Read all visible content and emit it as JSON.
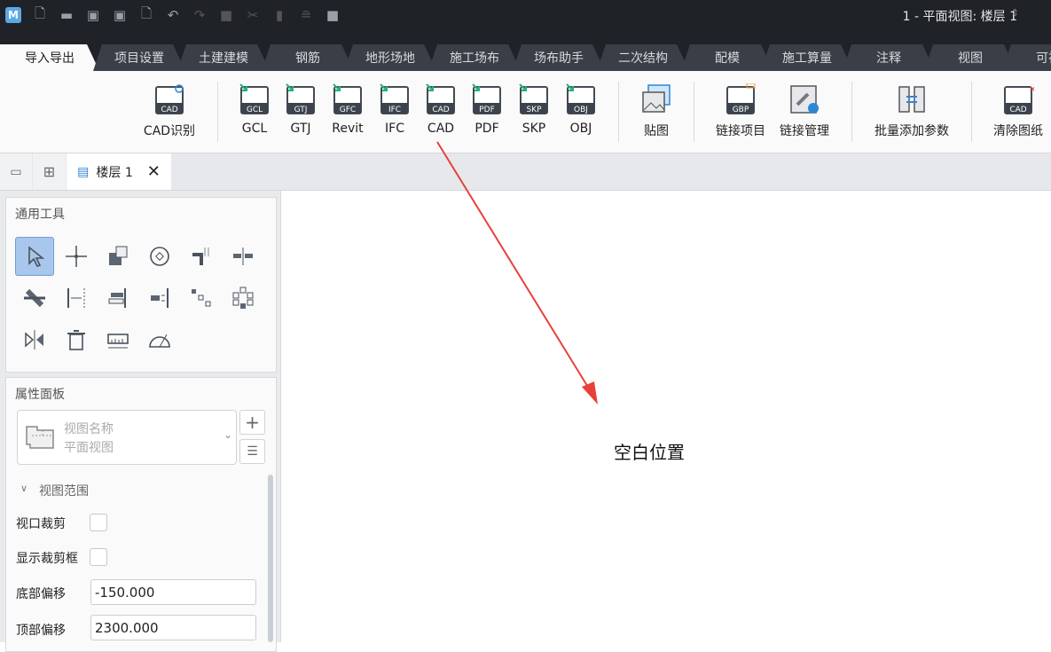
{
  "window": {
    "title": "1 - 平面视图: 楼层 1"
  },
  "quick_access": [
    "app-logo",
    "new-file",
    "open-folder",
    "save",
    "save-as",
    "close-file",
    "undo",
    "redo",
    "select-box",
    "cut",
    "paste",
    "stamp",
    "cube"
  ],
  "ribbon_tabs": [
    "导入导出",
    "项目设置",
    "土建建模",
    "钢筋",
    "地形场地",
    "施工场布",
    "场布助手",
    "二次结构",
    "配模",
    "施工算量",
    "注释",
    "视图",
    "可视"
  ],
  "ribbon_buttons": [
    {
      "label": "CAD识别",
      "badge": "CAD"
    },
    {
      "label": "GCL",
      "badge": "GCL"
    },
    {
      "label": "GTJ",
      "badge": "GTJ"
    },
    {
      "label": "Revit",
      "badge": "GFC"
    },
    {
      "label": "IFC",
      "badge": "IFC"
    },
    {
      "label": "CAD",
      "badge": "CAD"
    },
    {
      "label": "PDF",
      "badge": "PDF"
    },
    {
      "label": "SKP",
      "badge": "SKP"
    },
    {
      "label": "OBJ",
      "badge": "OBJ"
    },
    {
      "label": "贴图",
      "badge": ""
    },
    {
      "label": "链接项目",
      "badge": "GBP"
    },
    {
      "label": "链接管理",
      "badge": ""
    },
    {
      "label": "批量添加参数",
      "badge": ""
    },
    {
      "label": "清除图纸",
      "badge": "CAD"
    }
  ],
  "doc_tab": {
    "label": "楼层 1"
  },
  "tools_panel": {
    "title": "通用工具"
  },
  "properties": {
    "title": "属性面板",
    "view_name_label": "视图名称",
    "view_name_value": "平面视图",
    "section": "视图范围",
    "viewport_crop": "视口裁剪",
    "show_crop_box": "显示裁剪框",
    "bottom_offset_label": "底部偏移",
    "bottom_offset": "-150.000",
    "top_offset_label": "顶部偏移",
    "top_offset": "2300.000"
  },
  "annotation": {
    "text": "空白位置",
    "color": "#e8403a"
  },
  "colors": {
    "accent": "#a9c6ec",
    "import_arrow": "#22b07d",
    "topbar": "#1f2227"
  }
}
